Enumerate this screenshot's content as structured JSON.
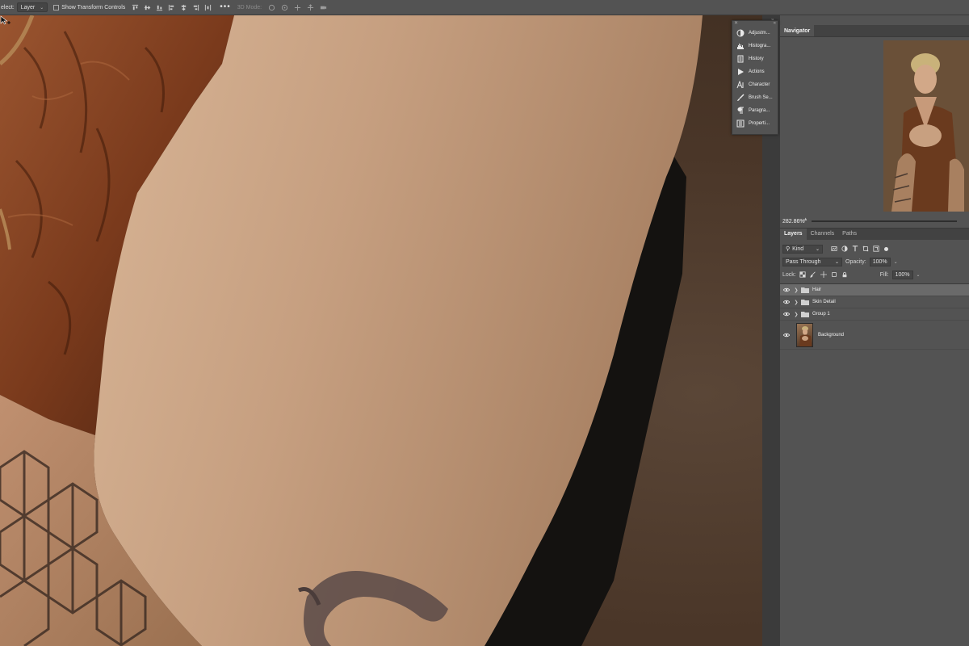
{
  "options_bar": {
    "select_label": "elect:",
    "layer_mode": "Layer",
    "show_transform_controls": "Show Transform Controls",
    "mode_3d": "3D Mode:"
  },
  "dock": {
    "items": [
      {
        "label": "Adjustm...",
        "icon": "adjustments-icon"
      },
      {
        "label": "Histogra...",
        "icon": "histogram-icon"
      },
      {
        "label": "History",
        "icon": "history-icon"
      },
      {
        "label": "Actions",
        "icon": "actions-play-icon"
      },
      {
        "label": "Character",
        "icon": "character-icon"
      },
      {
        "label": "Brush Se...",
        "icon": "brush-settings-icon"
      },
      {
        "label": "Paragra...",
        "icon": "paragraph-icon"
      },
      {
        "label": "Properti...",
        "icon": "properties-icon"
      }
    ]
  },
  "navigator": {
    "tab": "Navigator",
    "zoom": "282.86%"
  },
  "layers_panel": {
    "tabs": [
      "Layers",
      "Channels",
      "Paths"
    ],
    "filter_kind": "Kind",
    "blend_mode": "Pass Through",
    "opacity_label": "Opacity:",
    "opacity_value": "100%",
    "lock_label": "Lock:",
    "fill_label": "Fill:",
    "fill_value": "100%",
    "layers": [
      {
        "name": "Hair",
        "type": "group",
        "selected": true
      },
      {
        "name": "Skin Detail",
        "type": "group",
        "selected": false
      },
      {
        "name": "Group 1",
        "type": "group",
        "selected": false
      },
      {
        "name": "Background",
        "type": "image",
        "selected": false
      }
    ]
  },
  "colors": {
    "panel_bg": "#535353",
    "panel_dark": "#424242",
    "selected_row": "#6a6a6a",
    "skin": "#c09b7d",
    "leather": "#8a4a28"
  }
}
